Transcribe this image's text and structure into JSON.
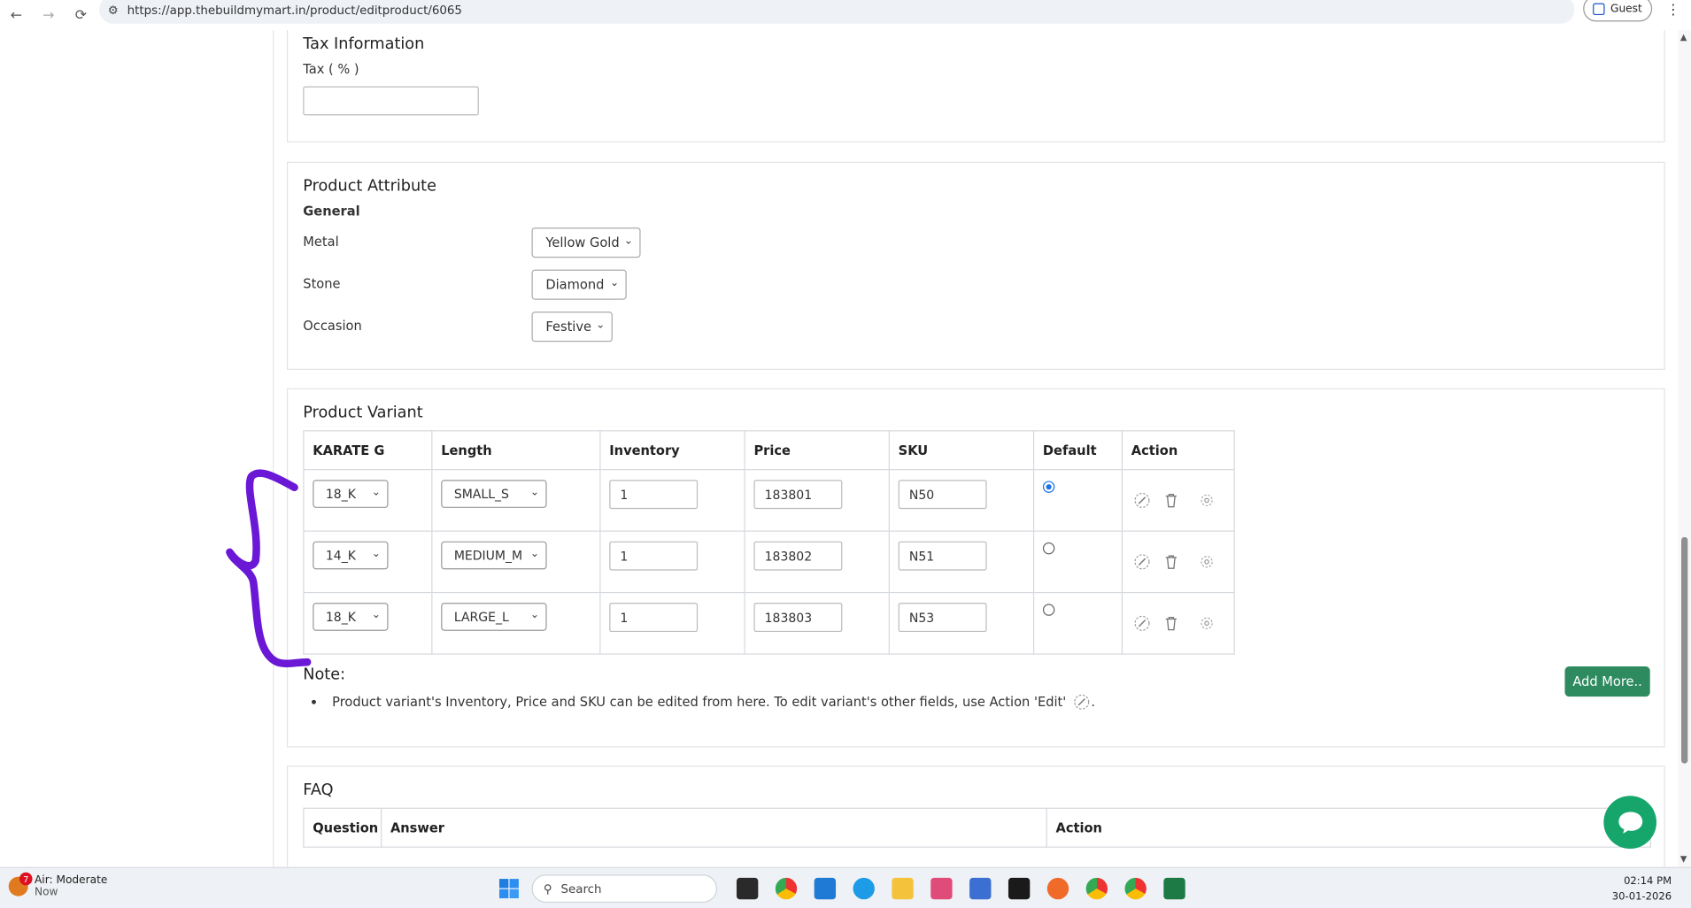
{
  "browser": {
    "url": "https://app.thebuildmymart.in/product/editproduct/6065",
    "profile_label": "Guest"
  },
  "tax_section": {
    "title": "Tax Information",
    "tax_label": "Tax ( % )",
    "tax_value": ""
  },
  "attribute_section": {
    "title": "Product Attribute",
    "group_label": "General",
    "rows": [
      {
        "label": "Metal",
        "value": "Yellow Gold"
      },
      {
        "label": "Stone",
        "value": "Diamond"
      },
      {
        "label": "Occasion",
        "value": "Festive"
      }
    ]
  },
  "variant_section": {
    "title": "Product Variant",
    "headers": [
      "KARATE G",
      "Length",
      "Inventory",
      "Price",
      "SKU",
      "Default",
      "Action"
    ],
    "rows": [
      {
        "karate": "18_K",
        "length": "SMALL_S",
        "inventory": "1",
        "price": "183801",
        "sku": "N50",
        "default": true
      },
      {
        "karate": "14_K",
        "length": "MEDIUM_M",
        "inventory": "1",
        "price": "183802",
        "sku": "N51",
        "default": false
      },
      {
        "karate": "18_K",
        "length": "LARGE_L",
        "inventory": "1",
        "price": "183803",
        "sku": "N53",
        "default": false
      }
    ],
    "note_title": "Note:",
    "note_text": "Product variant's Inventory, Price and SKU can be edited from here. To edit variant's other fields, use Action 'Edit'",
    "note_suffix": ".",
    "add_more_label": "Add More.."
  },
  "faq_section": {
    "title": "FAQ",
    "headers": [
      "Question",
      "Answer",
      "Action"
    ]
  },
  "taskbar": {
    "weather_badge": "7",
    "weather_title": "Air: Moderate",
    "weather_sub": "Now",
    "search_placeholder": "Search",
    "time": "02:14 PM",
    "date": "30-01-2026"
  },
  "colors": {
    "accent_green": "#2e8b5f",
    "chat_green": "#16a66b",
    "annotation_purple": "#6a17d6",
    "radio_blue": "#1a73e8"
  }
}
